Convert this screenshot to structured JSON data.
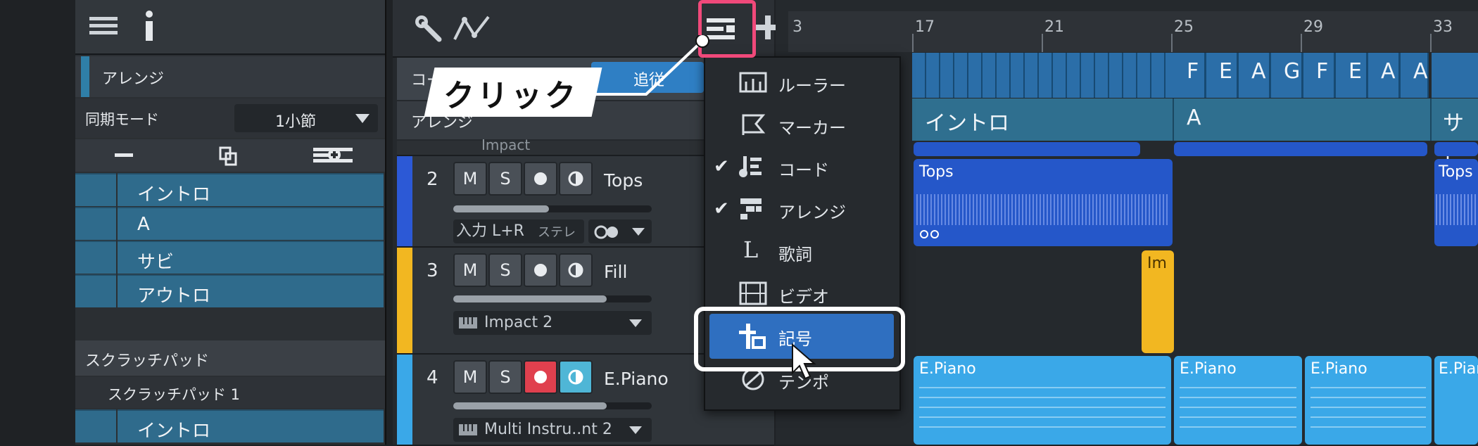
{
  "left_panel": {
    "section_title": "アレンジ",
    "sync_mode_label": "同期モード",
    "sync_mode_value": "1小節",
    "arrange_items": [
      "イントロ",
      "A",
      "サビ",
      "アウトロ"
    ],
    "scratchpad_header": "スクラッチパッド",
    "scratchpad_name": "スクラッチパッド 1",
    "scratchpad_items": [
      "イントロ"
    ]
  },
  "track_area": {
    "chord_label": "コー",
    "follow_button": "追従",
    "arrange_label": "アレンジ",
    "impact_preset": "Impact",
    "tracks": [
      {
        "number": "2",
        "name": "Tops",
        "input": "入力 L+R",
        "stereo": "ステレオ",
        "slider": 0.48
      },
      {
        "number": "3",
        "name": "Fill",
        "instrument": "Impact 2",
        "slider": 0.77
      },
      {
        "number": "4",
        "name": "E.Piano",
        "instrument": "Multi Instru..nt 2",
        "slider": 0.77
      }
    ],
    "mute_label": "M",
    "solo_label": "S"
  },
  "ruler": {
    "bars": [
      "3",
      "17",
      "21",
      "25",
      "29",
      "33"
    ]
  },
  "chord_track": {
    "chords": [
      "F",
      "E",
      "A",
      "G",
      "F",
      "E",
      "A",
      "A"
    ]
  },
  "arranger_track": {
    "sections": [
      "イントロ",
      "A",
      "サビ"
    ]
  },
  "clips": {
    "tops": [
      "Tops",
      "Tops"
    ],
    "fill": "Im",
    "piano": [
      "E.Piano",
      "E.Piano",
      "E.Piano",
      "E.Piano"
    ]
  },
  "menu": {
    "items": [
      {
        "label": "ルーラー",
        "checked": false
      },
      {
        "label": "マーカー",
        "checked": false
      },
      {
        "label": "コード",
        "checked": true
      },
      {
        "label": "アレンジ",
        "checked": true
      },
      {
        "label": "歌詞",
        "checked": false
      },
      {
        "label": "ビデオ",
        "checked": false
      },
      {
        "label": "記号",
        "checked": false
      },
      {
        "label": "テンポ",
        "checked": false
      }
    ],
    "highlighted": "記号"
  },
  "annotation": {
    "callout": "クリック"
  },
  "colors": {
    "accent_pink": "#f0497a",
    "menu_highlight": "#2f6fc0",
    "arranger_teal": "#2f6b8c",
    "clip_blue": "#2557c9",
    "clip_light_blue": "#3aa8e8",
    "fill_yellow": "#f2b721",
    "record_red": "#e0404e"
  }
}
